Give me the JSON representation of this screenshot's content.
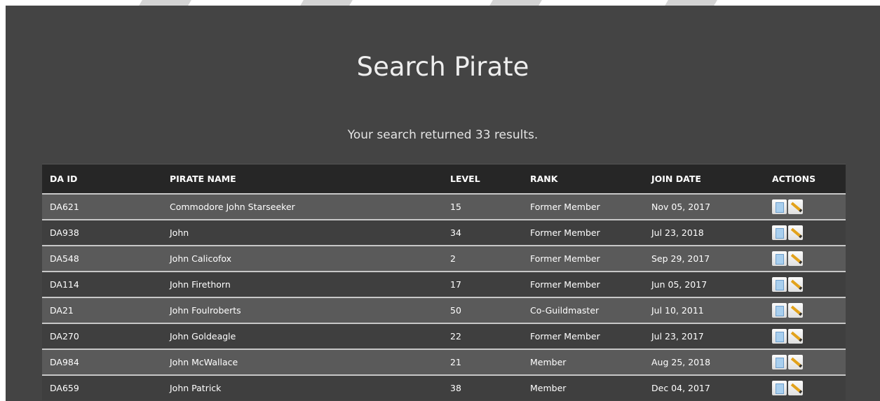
{
  "page": {
    "title": "Search Pirate",
    "summary": "Your search returned 33 results."
  },
  "table": {
    "columns": [
      "DA ID",
      "PIRATE NAME",
      "LEVEL",
      "RANK",
      "JOIN DATE",
      "ACTIONS"
    ],
    "rows": [
      {
        "id": "DA621",
        "name": "Commodore John Starseeker",
        "level": "15",
        "rank": "Former Member",
        "join": "Nov 05, 2017"
      },
      {
        "id": "DA938",
        "name": "John",
        "level": "34",
        "rank": "Former Member",
        "join": "Jul 23, 2018"
      },
      {
        "id": "DA548",
        "name": "John Calicofox",
        "level": "2",
        "rank": "Former Member",
        "join": "Sep 29, 2017"
      },
      {
        "id": "DA114",
        "name": "John Firethorn",
        "level": "17",
        "rank": "Former Member",
        "join": "Jun 05, 2017"
      },
      {
        "id": "DA21",
        "name": "John Foulroberts",
        "level": "50",
        "rank": "Co-Guildmaster",
        "join": "Jul 10, 2011"
      },
      {
        "id": "DA270",
        "name": "John Goldeagle",
        "level": "22",
        "rank": "Former Member",
        "join": "Jul 23, 2017"
      },
      {
        "id": "DA984",
        "name": "John McWallace",
        "level": "21",
        "rank": "Member",
        "join": "Aug 25, 2018"
      },
      {
        "id": "DA659",
        "name": "John Patrick",
        "level": "38",
        "rank": "Member",
        "join": "Dec 04, 2017"
      }
    ]
  },
  "icons": {
    "view": "document-icon",
    "edit": "pencil-icon"
  },
  "colors": {
    "panel": "#444444",
    "header": "#262626",
    "row_odd": "#5a5a5a",
    "row_even": "#3f3f3f"
  }
}
